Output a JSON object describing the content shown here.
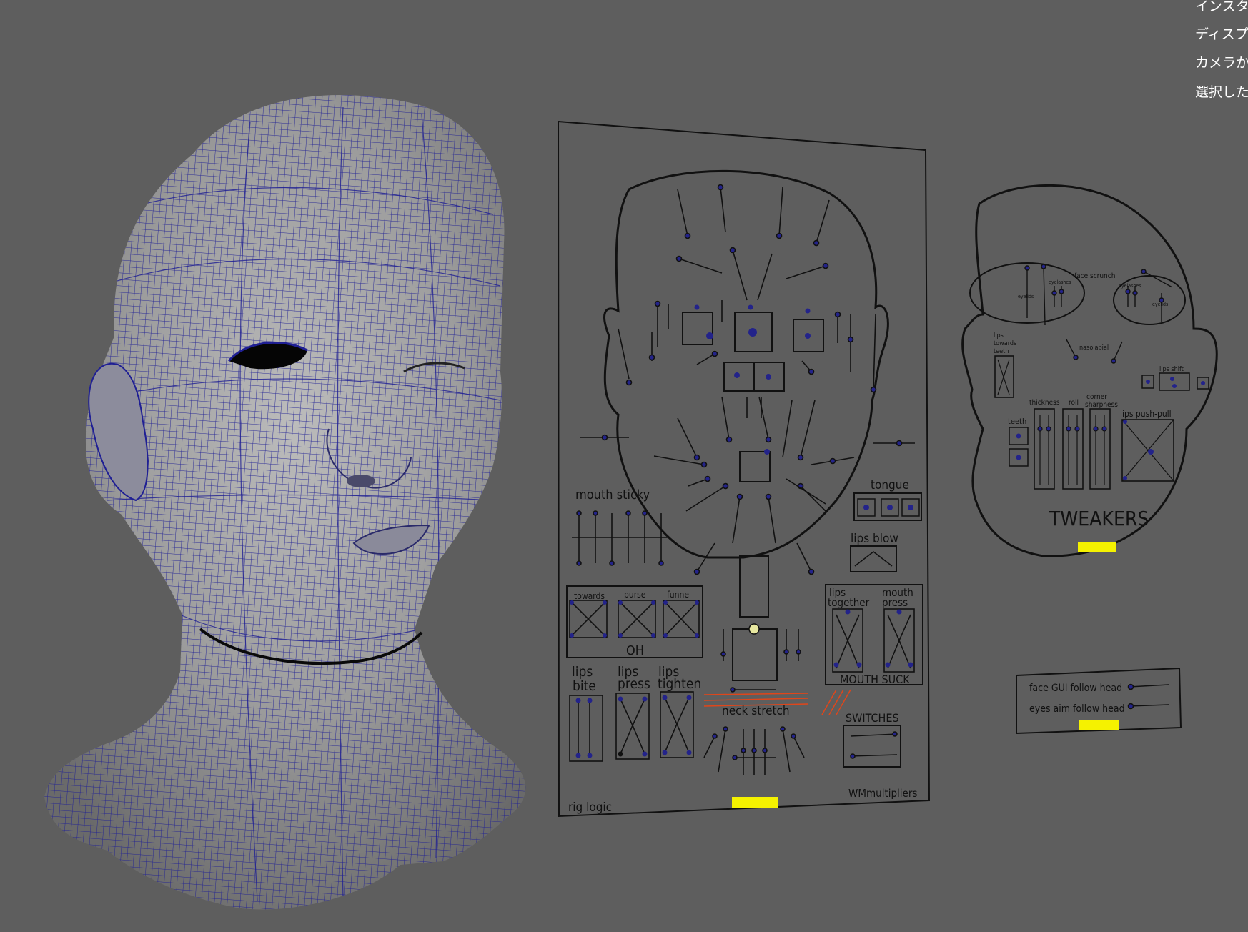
{
  "viewport": {
    "background": "#5e5e5e",
    "wire_color": "#1c1c8c"
  },
  "context_menu": {
    "items": [
      "インスタンス",
      "ディスプレイ",
      "カメラから",
      "選択した"
    ]
  },
  "rig_panel": {
    "mouth_sticky": "mouth sticky",
    "tongue": "tongue",
    "lips_blow": "lips blow",
    "oh_shapes": [
      "towards",
      "purse",
      "funnel"
    ],
    "oh": "OH",
    "lips_together_1": "lips",
    "lips_together_2": "together",
    "mouth_press_1": "mouth",
    "mouth_press_2": "press",
    "mouth_suck": "MOUTH SUCK",
    "lips_1": "lips",
    "bite": "bite",
    "press": "press",
    "tighten": "tighten",
    "neck_stretch": "neck stretch",
    "switches": "SWITCHES",
    "rig_logic": "rig logic",
    "multipliers": "WMmultipliers"
  },
  "tweakers_panel": {
    "face_scrunch": "face scrunch",
    "eyelids_left": "eyelids",
    "eyelashes_left": "eyelashes",
    "eyelashes_right": "eyelashes",
    "eyelids_right": "eyelids",
    "lips_towards_1": "lips",
    "lips_towards_2": "towards",
    "lips_towards_3": "teeth",
    "nasolabial": "nasolabial",
    "lips_shift": "lips shift",
    "teeth": "teeth",
    "thickness": "thickness",
    "roll": "roll",
    "corner": "corner",
    "sharpness": "sharpness",
    "lips_push_pull": "lips push-pull",
    "title": "TWEAKERS"
  },
  "switches_panel": {
    "face_gui_follow_head": "face GUI follow head",
    "eyes_aim_follow_head": "eyes aim follow head"
  },
  "colors": {
    "highlight": "#f5f200",
    "handle": "#23238a",
    "outline": "#111111",
    "accent": "#e0461a"
  }
}
